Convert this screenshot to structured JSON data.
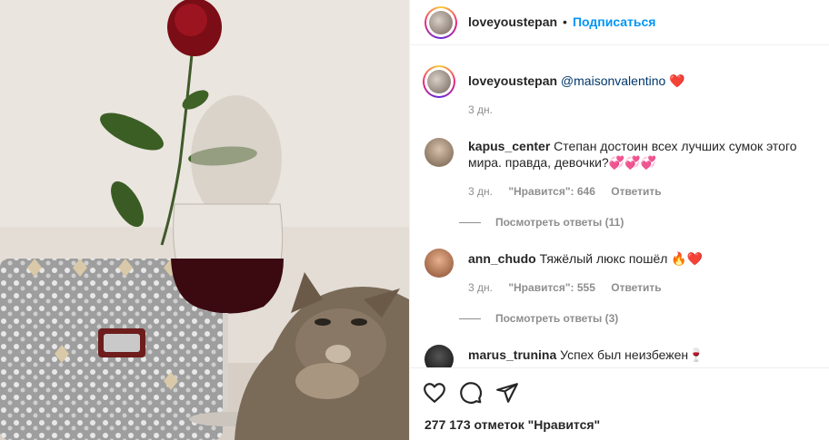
{
  "post": {
    "author": "loveyoustepan",
    "follow_label": "Подписаться",
    "separator": "•"
  },
  "caption": {
    "username": "loveyoustepan",
    "mention": "@maisonvalentino",
    "emoji": "❤️",
    "time": "3 дн."
  },
  "comments": [
    {
      "username": "kapus_center",
      "text_line1": "Степан достоин всех лучших сумок этого",
      "text_line2": "мира. правда, девочки?💞💞💞",
      "time": "3 дн.",
      "likes": "\"Нравится\": 646",
      "reply": "Ответить",
      "view_replies": "Посмотреть ответы (11)"
    },
    {
      "username": "ann_chudo",
      "text": "Тяжёлый люкс пошёл 🔥❤️",
      "time": "3 дн.",
      "likes": "\"Нравится\": 555",
      "reply": "Ответить",
      "view_replies": "Посмотреть ответы (3)"
    },
    {
      "username": "marus_trunina",
      "text": "Успех был неизбежен🍷"
    }
  ],
  "likes_count": "277 173 отметок \"Нравится\"",
  "icons": [
    "heart-icon",
    "comment-icon",
    "share-icon"
  ]
}
